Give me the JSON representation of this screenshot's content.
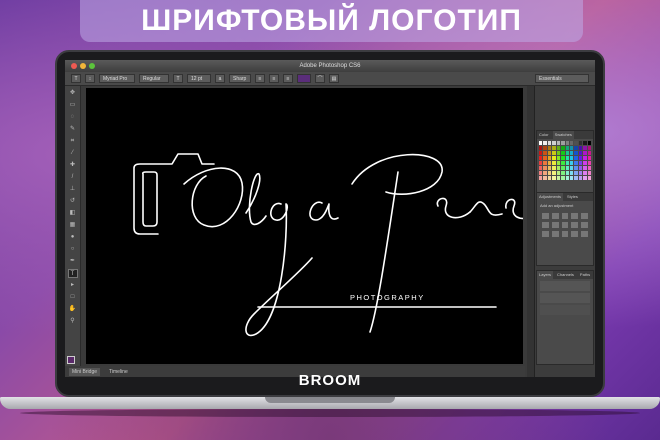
{
  "banner": {
    "title": "ШРИФТОВЫЙ ЛОГОТИП"
  },
  "laptop": {
    "brand": "BROOM"
  },
  "photoshop": {
    "window_title": "Adobe Photoshop CS6",
    "options": {
      "font_family": "Myriad Pro",
      "font_style": "Regular",
      "font_size": "12 pt",
      "antialias": "Sharp",
      "workspace": "Essentials",
      "text_color": "#5a2d7a"
    },
    "doc_tabs": [
      "Mini Bridge",
      "Timeline"
    ],
    "panels": {
      "color_tabs": [
        "Color",
        "Swatches"
      ],
      "adjustments_tabs": [
        "Adjustments",
        "Styles"
      ],
      "adjustments_hint": "Add an adjustment",
      "layers_tabs": [
        "Layers",
        "Channels",
        "Paths"
      ]
    }
  },
  "logo": {
    "name": "Olga Pere",
    "tagline": "PHOTOGRAPHY"
  }
}
